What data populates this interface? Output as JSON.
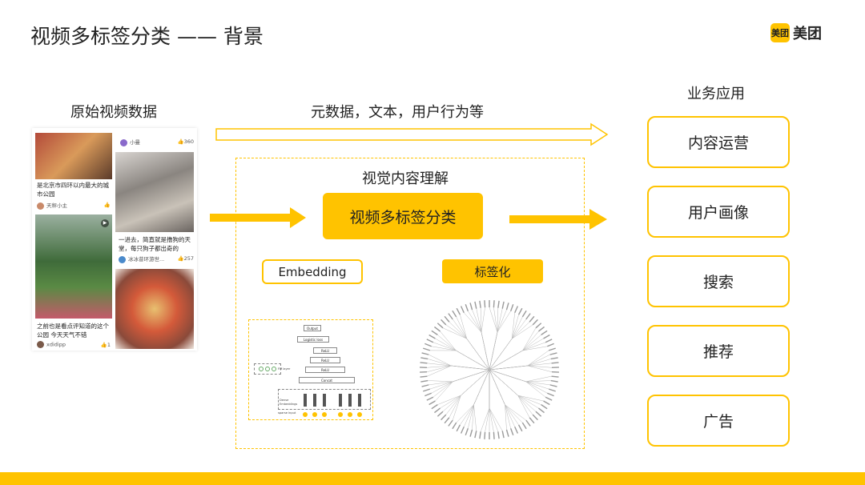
{
  "slide": {
    "title": "视频多标签分类 —— 背景",
    "logo": {
      "icon_text": "美团",
      "text": "美团",
      "icon": "meituan-logo-icon",
      "brand_color": "#FFC300"
    }
  },
  "raw_video": {
    "label": "原始视频数据",
    "feed": {
      "cards": [
        {
          "caption": "是北京市四环以内最大的城市公园",
          "user": "天秤小主",
          "likes": ""
        },
        {
          "caption": "",
          "user": "小曼",
          "likes": "360"
        },
        {
          "caption": "一进去，简直就是撸狗的天堂，每只狗子都出奇的",
          "user": "冰冰昔环游世...",
          "likes": "257"
        },
        {
          "caption": "之前也是看点评知道的这个公园 今天天气不错",
          "user": "xdidipp",
          "likes": "1"
        }
      ]
    }
  },
  "metadata_arrow": {
    "label": "元数据，文本，用户行为等"
  },
  "visual": {
    "label": "视觉内容理解",
    "main_box": "视频多标签分类",
    "embedding": "Embedding",
    "tagging": "标签化",
    "nn_diagram": {
      "output": "Output",
      "logistic": "Logistic loss",
      "relu": "ReLU",
      "concat": "Concat",
      "fm": "FM layer",
      "dense": "Dense Embeddings",
      "sparse": "sparse input"
    }
  },
  "applications": {
    "label": "业务应用",
    "items": [
      "内容运营",
      "用户画像",
      "搜索",
      "推荐",
      "广告"
    ]
  },
  "colors": {
    "accent": "#FFC300",
    "text": "#222222"
  }
}
